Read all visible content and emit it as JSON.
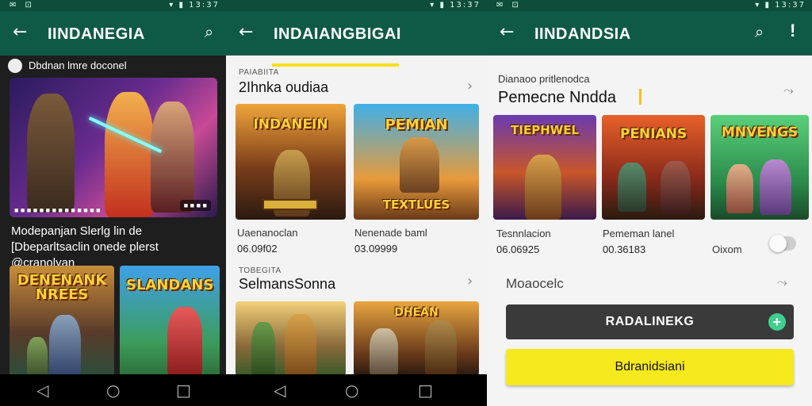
{
  "screen1": {
    "title": "IINDANEGIA",
    "featured_header": "Dbdnan lmre doconel",
    "hero_caption": "■ ■ ■ ■ ■ ■ ■ ■ ■ ■ ■ ■ ■ ■",
    "hero_badge": "■ ■ ■ ■",
    "description": "Modepanjan Slerlg lin de [Dbeparltsaclin onede plerst @cranolyan",
    "games": [
      {
        "logo": "DENENANK NREES"
      },
      {
        "logo": "SLANDANS"
      }
    ]
  },
  "screen2": {
    "title": "INDAIANGBIGAI",
    "section1": {
      "label": "PAIABIITA",
      "title": "2Ihnka oudiaa",
      "cards": [
        {
          "logo": "INDANEIN",
          "name": "Uaenanoclan",
          "price": "06.09f02"
        },
        {
          "logo": "PEMIAN",
          "sub": "TEXTLUES",
          "name": "Nenenade baml",
          "price": "03.09999"
        }
      ]
    },
    "section2": {
      "label": "TOBEGITA",
      "title": "SelmansSonna",
      "cards": [
        {
          "logo": ""
        },
        {
          "logo": "DHEAN"
        }
      ]
    }
  },
  "screen3": {
    "title": "IINDANDSIA",
    "label": "Dianaoo pritlenodca",
    "title_text": "Pemecne Nndda",
    "cards": [
      {
        "logo": "TIEPHWEL",
        "name": "Tesnnlacion",
        "price": "06.06925"
      },
      {
        "logo": "PENIANS",
        "name": "Pememan lanel",
        "price": "00.36183"
      },
      {
        "logo": "MNVENGS",
        "name": "Oixom",
        "price": ""
      }
    ],
    "section_label": "Moaocelc",
    "primary_button": "RADALINEKG",
    "secondary_button": "Bdranidsiani"
  },
  "statusbar": {
    "left": "✉ ⊡",
    "right": "▾ ▮ 13:37"
  },
  "nav": {
    "back": "◁",
    "home": "○",
    "recent": "□"
  },
  "colors": {
    "appbar": "#0f5a45",
    "accent_yellow": "#f6e91e",
    "toggle_off": "#cfcfcf",
    "plus_green": "#3fcf8e"
  }
}
